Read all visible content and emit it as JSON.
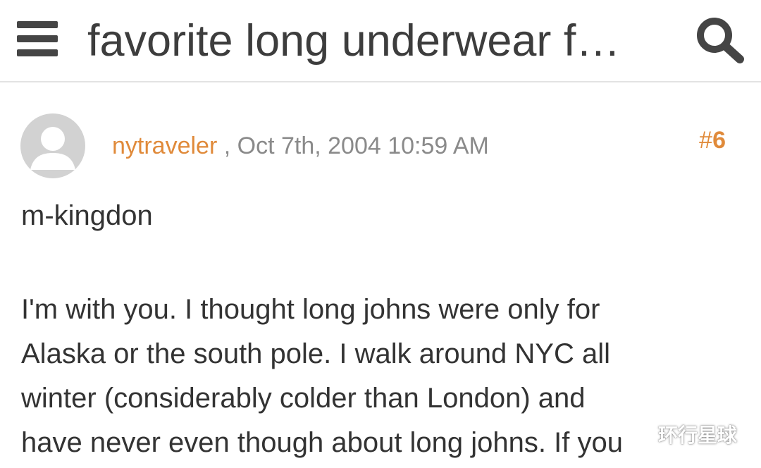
{
  "header": {
    "title": "favorite long underwear f…",
    "menu_icon": "hamburger-menu-icon",
    "search_icon": "search-icon"
  },
  "post": {
    "username": "nytraveler",
    "separator": " , ",
    "date": "Oct 7th, 2004 10:59 AM",
    "post_number_hash": "#",
    "post_number": "6",
    "avatar_icon": "default-avatar-icon",
    "quoted_user": "m-kingdon",
    "body_lines": [
      "I'm with you. I thought long johns were only for",
      "Alaska or the south pole. I walk around NYC all",
      "winter (considerably colder than London) and",
      "have never even though about long johns. If you"
    ]
  },
  "watermark": {
    "text": "环行星球"
  },
  "colors": {
    "accent": "#e08a3a",
    "text": "#333333",
    "muted": "#8a8a8a",
    "icon": "#454545",
    "avatar_bg": "#d2d2d2",
    "divider": "#e3e3e3"
  }
}
